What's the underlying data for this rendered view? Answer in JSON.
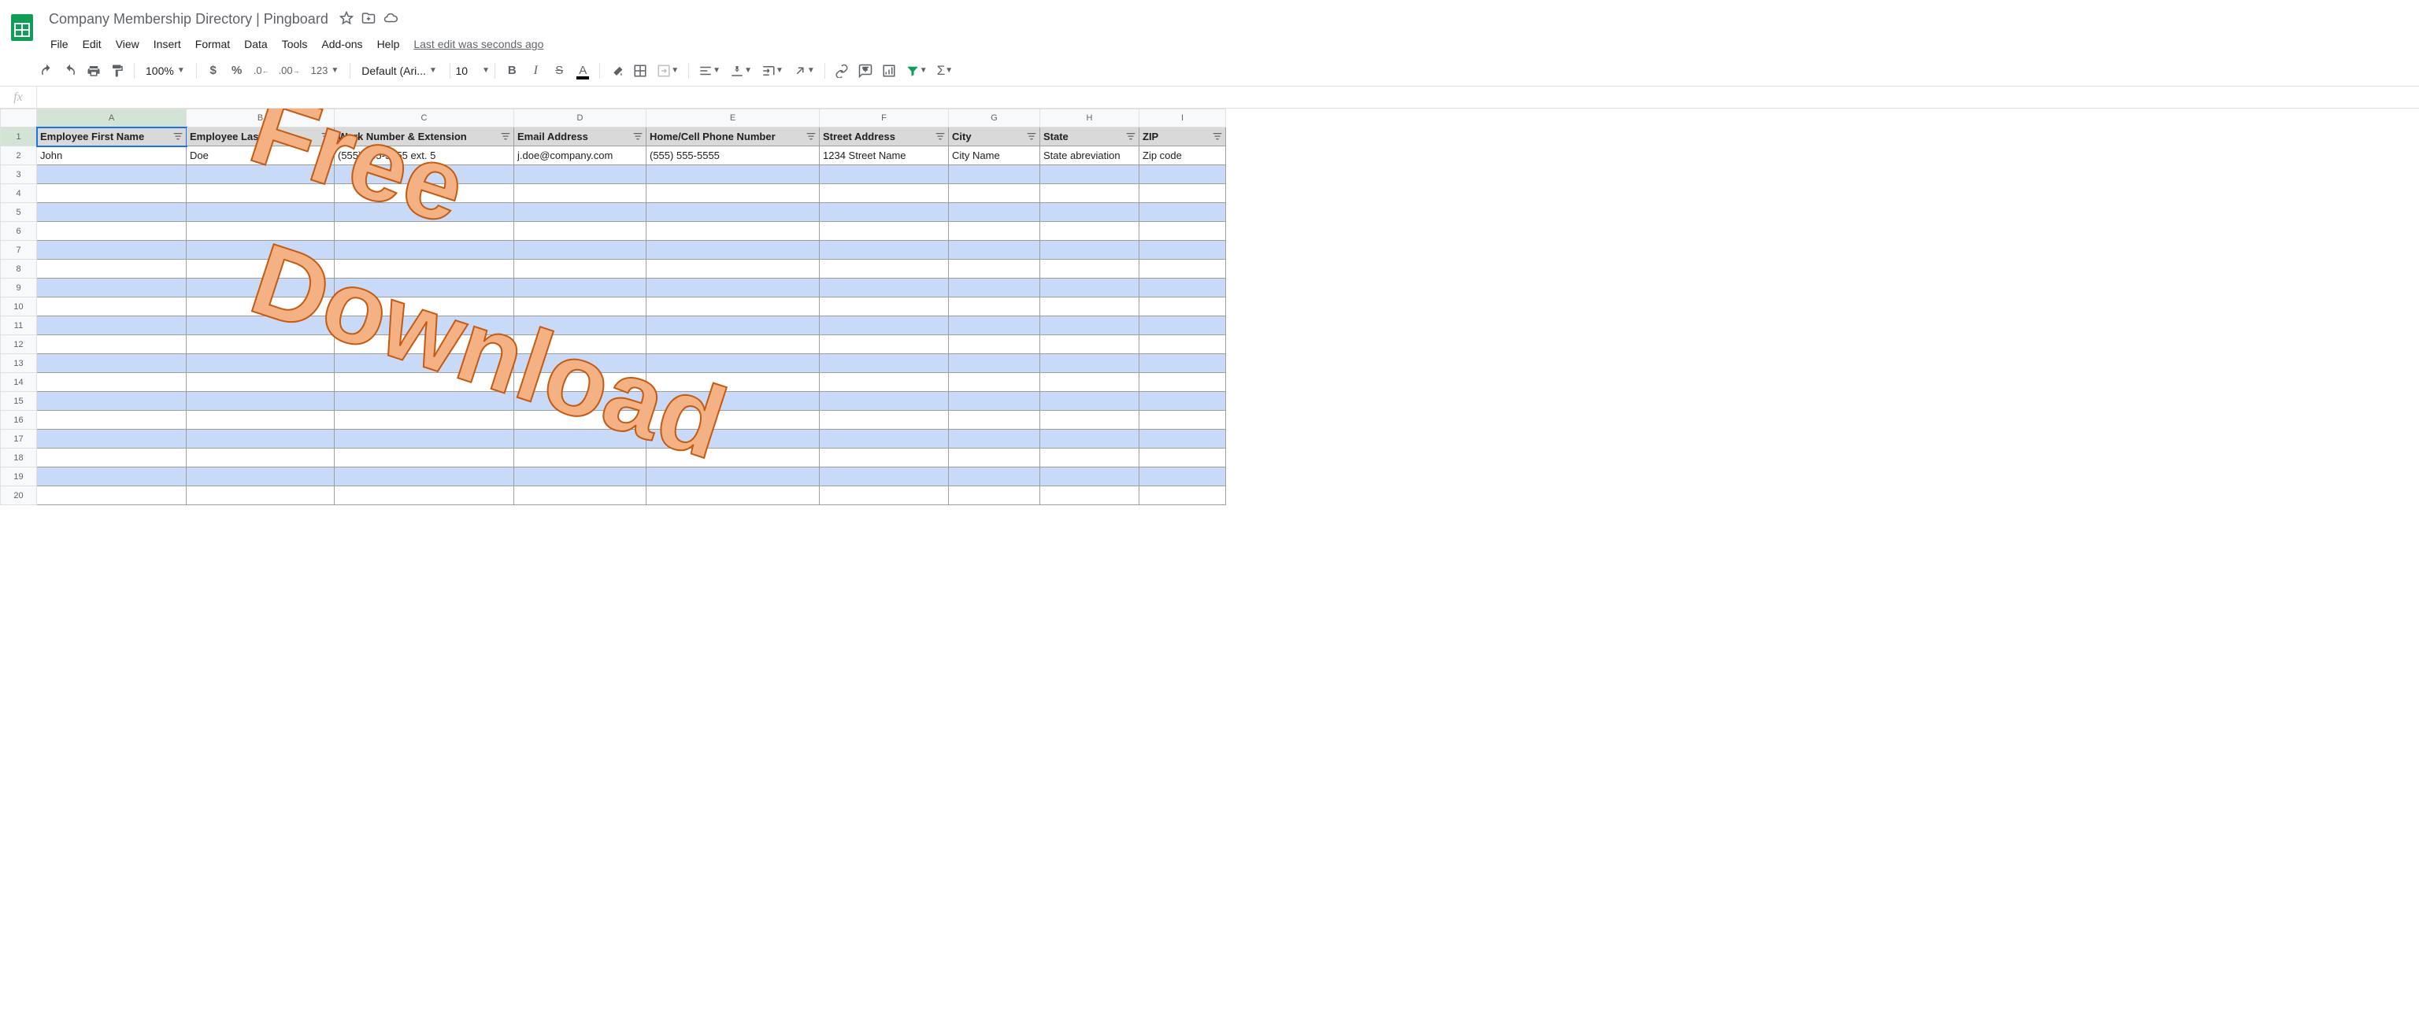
{
  "doc_title": "Company Membership Directory | Pingboard",
  "menus": [
    "File",
    "Edit",
    "View",
    "Insert",
    "Format",
    "Data",
    "Tools",
    "Add-ons",
    "Help"
  ],
  "last_edit": "Last edit was seconds ago",
  "toolbar": {
    "zoom": "100%",
    "font": "Default (Ari...",
    "font_size": "10"
  },
  "columns": [
    "A",
    "B",
    "C",
    "D",
    "E",
    "F",
    "G",
    "H",
    "I"
  ],
  "col_widths": [
    "col-a",
    "col-b",
    "col-c",
    "col-d",
    "col-e",
    "col-f",
    "col-g",
    "col-h",
    "col-i"
  ],
  "headers": [
    "Employee First Name",
    "Employee Last Name",
    "Work Number & Extension",
    "Email Address",
    "Home/Cell Phone Number",
    "Street Address",
    "City",
    "State",
    "ZIP"
  ],
  "row2": [
    "John",
    "Doe",
    "(555) 555-5555 ext. 5",
    "j.doe@company.com",
    "(555) 555-5555",
    "1234 Street Name",
    "City Name",
    "State abreviation",
    "Zip code"
  ],
  "num_rows": 20,
  "watermark": {
    "line1": "Free",
    "line2": "Download"
  }
}
